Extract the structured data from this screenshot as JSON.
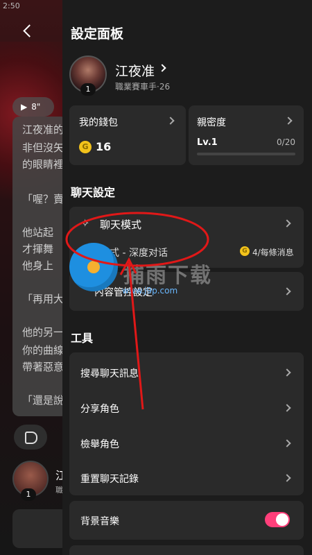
{
  "background": {
    "status_time": "2:50",
    "audio_label": "8\"",
    "lines": [
      "江夜准的",
      "非但沒矢",
      "的眼睛裡",
      "「喔？賣",
      "他站起",
      "才揮舞",
      "他身上",
      "「再用大",
      "他的另一",
      "你的曲線",
      "帶著惡意",
      "「還是說"
    ],
    "avatar_badge": "1",
    "name": "江",
    "sub": "職"
  },
  "panel": {
    "title": "設定面板",
    "profile": {
      "name": "江夜准",
      "subtitle": "職業賽車手·26",
      "badge": "1"
    },
    "wallet": {
      "label": "我的錢包",
      "coin_symbol": "G",
      "amount": "16"
    },
    "intimacy": {
      "label": "親密度",
      "level": "Lv.1",
      "progress_text": "0/20",
      "progress": 0
    },
    "chat_settings_title": "聊天設定",
    "chat_mode": {
      "label": "聊天模式",
      "mode_text": "劇情模式 - 深度对话",
      "coin_symbol": "G",
      "cost": "4/每條消息"
    },
    "content_control": {
      "label": "內容管控設定"
    },
    "tools_title": "工具",
    "tools": [
      {
        "label": "搜尋聊天訊息"
      },
      {
        "label": "分享角色"
      },
      {
        "label": "檢舉角色"
      },
      {
        "label": "重置聊天記錄"
      }
    ],
    "bgm": {
      "label": "背景音樂",
      "enabled": true
    }
  },
  "watermark": {
    "text": "捕雨下载",
    "url": "www.j9p.com"
  },
  "colors": {
    "toggle_on": "#ff3f7a",
    "coin": "#f2c21b",
    "annotation": "#e01818"
  }
}
